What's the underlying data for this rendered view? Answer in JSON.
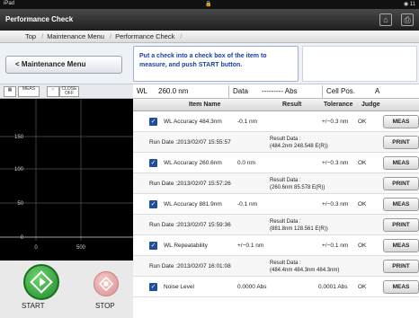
{
  "status": {
    "device": "iPad",
    "right": "11"
  },
  "header": {
    "title": "Performance Check"
  },
  "breadcrumb": [
    "Top",
    "Maintenance Menu",
    "Performance Check"
  ],
  "back_label": "< Maintenance Menu",
  "instruction": "Put a check into a check box of the item to measure, and push START button.",
  "tools": {
    "meas": "MEAS",
    "close": "CLOSE",
    "off": "OFF"
  },
  "info": {
    "wl_label": "WL",
    "wl_value": "260.0 nm",
    "data_label": "Data",
    "data_value": "--------- Abs",
    "cell_label": "Cell Pos.",
    "cell_value": "A"
  },
  "graph": {
    "y_ticks": [
      "150",
      "100",
      "50",
      "0"
    ],
    "x_ticks": [
      "0",
      "500"
    ]
  },
  "controls": {
    "start": "START",
    "stop": "STOP"
  },
  "table": {
    "headers": {
      "item": "Item Name",
      "result": "Result",
      "tolerance": "Tolerance",
      "judge": "Judge"
    },
    "rows": [
      {
        "item": "WL Accuracy 484.3nm",
        "result": "-0.1 nm",
        "tolerance": "+/−0.3 nm",
        "judge": "OK",
        "run_date": "Run Date :2013/02/07 15:55:57",
        "result_data_1": "Result Data :",
        "result_data_2": "(484.2nm 248.548 E(R))"
      },
      {
        "item": "WL Accuracy 260.6nm",
        "result": "0.0 nm",
        "tolerance": "+/−0.3 nm",
        "judge": "OK",
        "run_date": "Run Date :2013/02/07 15:57:26",
        "result_data_1": "Result Data :",
        "result_data_2": "(260.6nm 85.578 E(R))"
      },
      {
        "item": "WL Accuracy 881.9nm",
        "result": "-0.1 nm",
        "tolerance": "+/−0.3 nm",
        "judge": "OK",
        "run_date": "Run Date :2013/02/07 15:59:36",
        "result_data_1": "Result Data :",
        "result_data_2": "(881.8nm 128.561 E(R))"
      },
      {
        "item": "WL Repeatability",
        "result": "+/−0.1 nm",
        "tolerance": "+/−0.1 nm",
        "judge": "OK",
        "run_date": "Run Date :2013/02/07 16:01:08",
        "result_data_1": "Result Data :",
        "result_data_2": "(484.4nm 484.3nm 484.3nm)"
      },
      {
        "item": "Noise Level",
        "result": "0.0000 Abs",
        "tolerance": "0.0001 Abs",
        "judge": "OK"
      }
    ],
    "meas_label": "MEAS",
    "print_label": "PRINT"
  }
}
